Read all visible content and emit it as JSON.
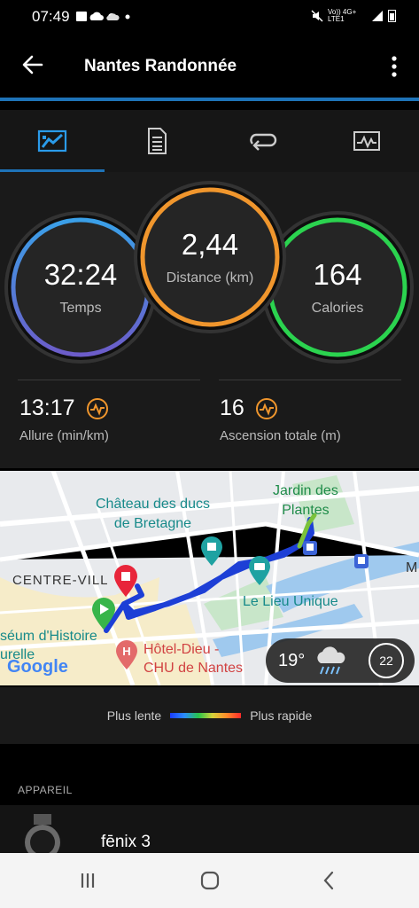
{
  "status_bar": {
    "time": "07:49",
    "network_text": "Vo)) 4G+ LTE1",
    "left_icons": [
      "image-icon",
      "cloud-icon",
      "weather-icon",
      "dot-icon"
    ],
    "right_icons": [
      "mute-icon",
      "signal-icon",
      "battery-icon"
    ]
  },
  "app_bar": {
    "title": "Nantes Randonnée",
    "accent_color": "#1e73b8"
  },
  "tabs": [
    {
      "icon": "summary-chart-icon",
      "active": true
    },
    {
      "icon": "list-icon",
      "active": false
    },
    {
      "icon": "laps-icon",
      "active": false
    },
    {
      "icon": "graph-icon",
      "active": false
    }
  ],
  "rings": {
    "time": {
      "value": "32:24",
      "label": "Temps"
    },
    "distance": {
      "value": "2,44",
      "label": "Distance (km)"
    },
    "calories": {
      "value": "164",
      "label": "Calories"
    }
  },
  "metrics": {
    "pace": {
      "value": "13:17",
      "label": "Allure (min/km)"
    },
    "ascent": {
      "value": "16",
      "label": "Ascension totale (m)"
    }
  },
  "map": {
    "labels": {
      "jardin": "Jardin des\nPlantes",
      "chateau": "Château des ducs\nde Bretagne",
      "centre": "CENTRE-VILL",
      "lieu_unique": "Le Lieu Unique",
      "museum": "séum d'Histoire\nurelle",
      "hotel_dieu": "Hôtel-Dieu -\nCHU de Nantes",
      "m": "M",
      "google": "Google"
    },
    "weather": {
      "temperature": "19°",
      "wind": "22"
    }
  },
  "legend": {
    "slow": "Plus lente",
    "fast": "Plus rapide"
  },
  "device_section": {
    "header": "APPAREIL",
    "device_name": "fēnix 3"
  }
}
